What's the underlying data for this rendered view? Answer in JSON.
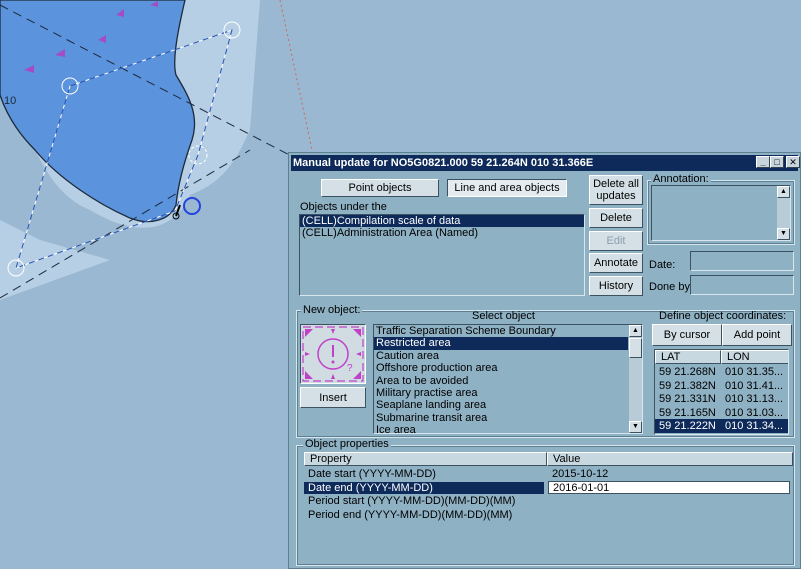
{
  "map": {
    "depth_label": "10"
  },
  "window": {
    "title": "Manual update for NO5G0821.000  59 21.264N  010 31.366E",
    "controls": {
      "minimize": "_",
      "maximize": "□",
      "close": "✕"
    }
  },
  "tabs": {
    "point": "Point objects",
    "line_area": "Line and area objects"
  },
  "objects_under": {
    "label": "Objects under the",
    "items": [
      "(CELL)Compilation scale of data",
      "(CELL)Administration Area (Named)"
    ]
  },
  "buttons": {
    "delete_all": "Delete all updates",
    "delete": "Delete",
    "edit": "Edit",
    "annotate": "Annotate",
    "history": "History",
    "insert": "Insert",
    "by_cursor": "By cursor",
    "add_point": "Add point"
  },
  "annotation": {
    "label": "Annotation:",
    "date_label": "Date:",
    "done_by_label": "Done by:"
  },
  "new_object": {
    "label": "New object:",
    "select_label": "Select object",
    "items": [
      "Traffic Separation Scheme  Boundary",
      "Restricted area",
      "Caution area",
      "Offshore production area",
      "Area to be avoided",
      "Military practise area",
      "Seaplane landing area",
      "Submarine transit area",
      "Ice area"
    ],
    "selected_index": 1
  },
  "coordinates": {
    "label": "Define object coordinates:",
    "headers": {
      "lat": "LAT",
      "lon": "LON"
    },
    "rows": [
      {
        "lat": "59 21.268N",
        "lon": "010 31.35..."
      },
      {
        "lat": "59 21.382N",
        "lon": "010 31.41..."
      },
      {
        "lat": "59 21.331N",
        "lon": "010 31.13..."
      },
      {
        "lat": "59 21.165N",
        "lon": "010 31.03..."
      },
      {
        "lat": "59 21.222N",
        "lon": "010 31.34..."
      }
    ],
    "selected_index": 4
  },
  "properties": {
    "label": "Object properties",
    "headers": {
      "property": "Property",
      "value": "Value"
    },
    "rows": [
      {
        "property": "Date start (YYYY-MM-DD)",
        "value": "2015-10-12"
      },
      {
        "property": "Date end (YYYY-MM-DD)",
        "value": "2016-01-01"
      },
      {
        "property": "Period start (YYYY-MM-DD)(MM-DD)(MM)",
        "value": ""
      },
      {
        "property": "Period end (YYYY-MM-DD)(MM-DD)(MM)",
        "value": ""
      }
    ],
    "selected_index": 1
  },
  "colors": {
    "land": "#5b93dc",
    "sea_shallow": "#b6cfe4",
    "sea_mid": "#9ab8d2",
    "selection": "#0d2a5a"
  }
}
